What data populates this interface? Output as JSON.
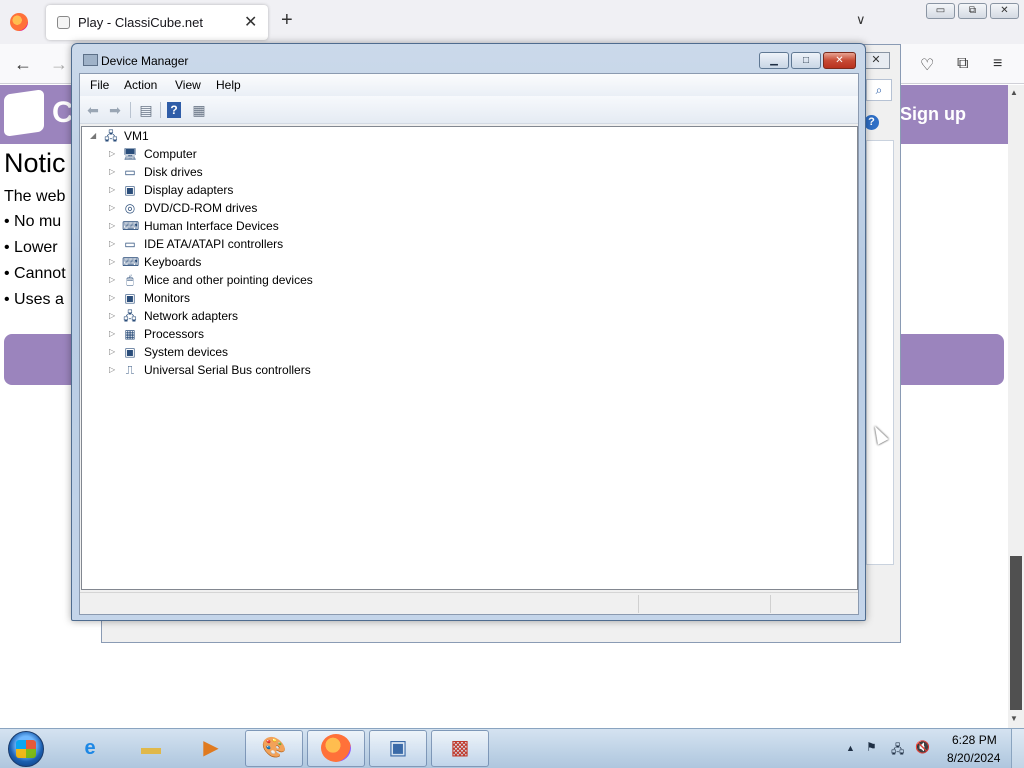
{
  "browser": {
    "tab_title": "Play - ClassiCube.net",
    "tab_close": "✕",
    "new_tab": "+",
    "list_tabs": "∨",
    "window_controls": {
      "minimize": "▭",
      "restore": "⧉",
      "close": "✕"
    },
    "nav": {
      "back": "←",
      "forward": "→"
    },
    "toolbar_icons": [
      "pocket-icon",
      "extensions-icon",
      "menu-icon"
    ]
  },
  "site": {
    "logo_text": "C",
    "signup": "Sign up",
    "notice_heading": "Notic",
    "lines": [
      "The web ",
      "• No mu",
      "• Lower ",
      "• Cannot",
      "• Uses a"
    ]
  },
  "background_dialog": {
    "close": "✕",
    "search_icon": "⌕",
    "help_icon": "?"
  },
  "device_manager": {
    "title": "Device Manager",
    "menu": [
      "File",
      "Action",
      "View",
      "Help"
    ],
    "tree": {
      "root": "VM1",
      "items": [
        "Computer",
        "Disk drives",
        "Display adapters",
        "DVD/CD-ROM drives",
        "Human Interface Devices",
        "IDE ATA/ATAPI controllers",
        "Keyboards",
        "Mice and other pointing devices",
        "Monitors",
        "Network adapters",
        "Processors",
        "System devices",
        "Universal Serial Bus controllers"
      ]
    },
    "colors": {
      "title_bar": "#b7cbe3",
      "close_button": "#c74a34"
    }
  },
  "taskbar": {
    "apps": [
      "internet-explorer",
      "windows-explorer",
      "media-player",
      "paint",
      "firefox",
      "device-manager-app",
      "toolbox-app"
    ],
    "clock": {
      "time": "6:28 PM",
      "date": "8/20/2024"
    }
  }
}
